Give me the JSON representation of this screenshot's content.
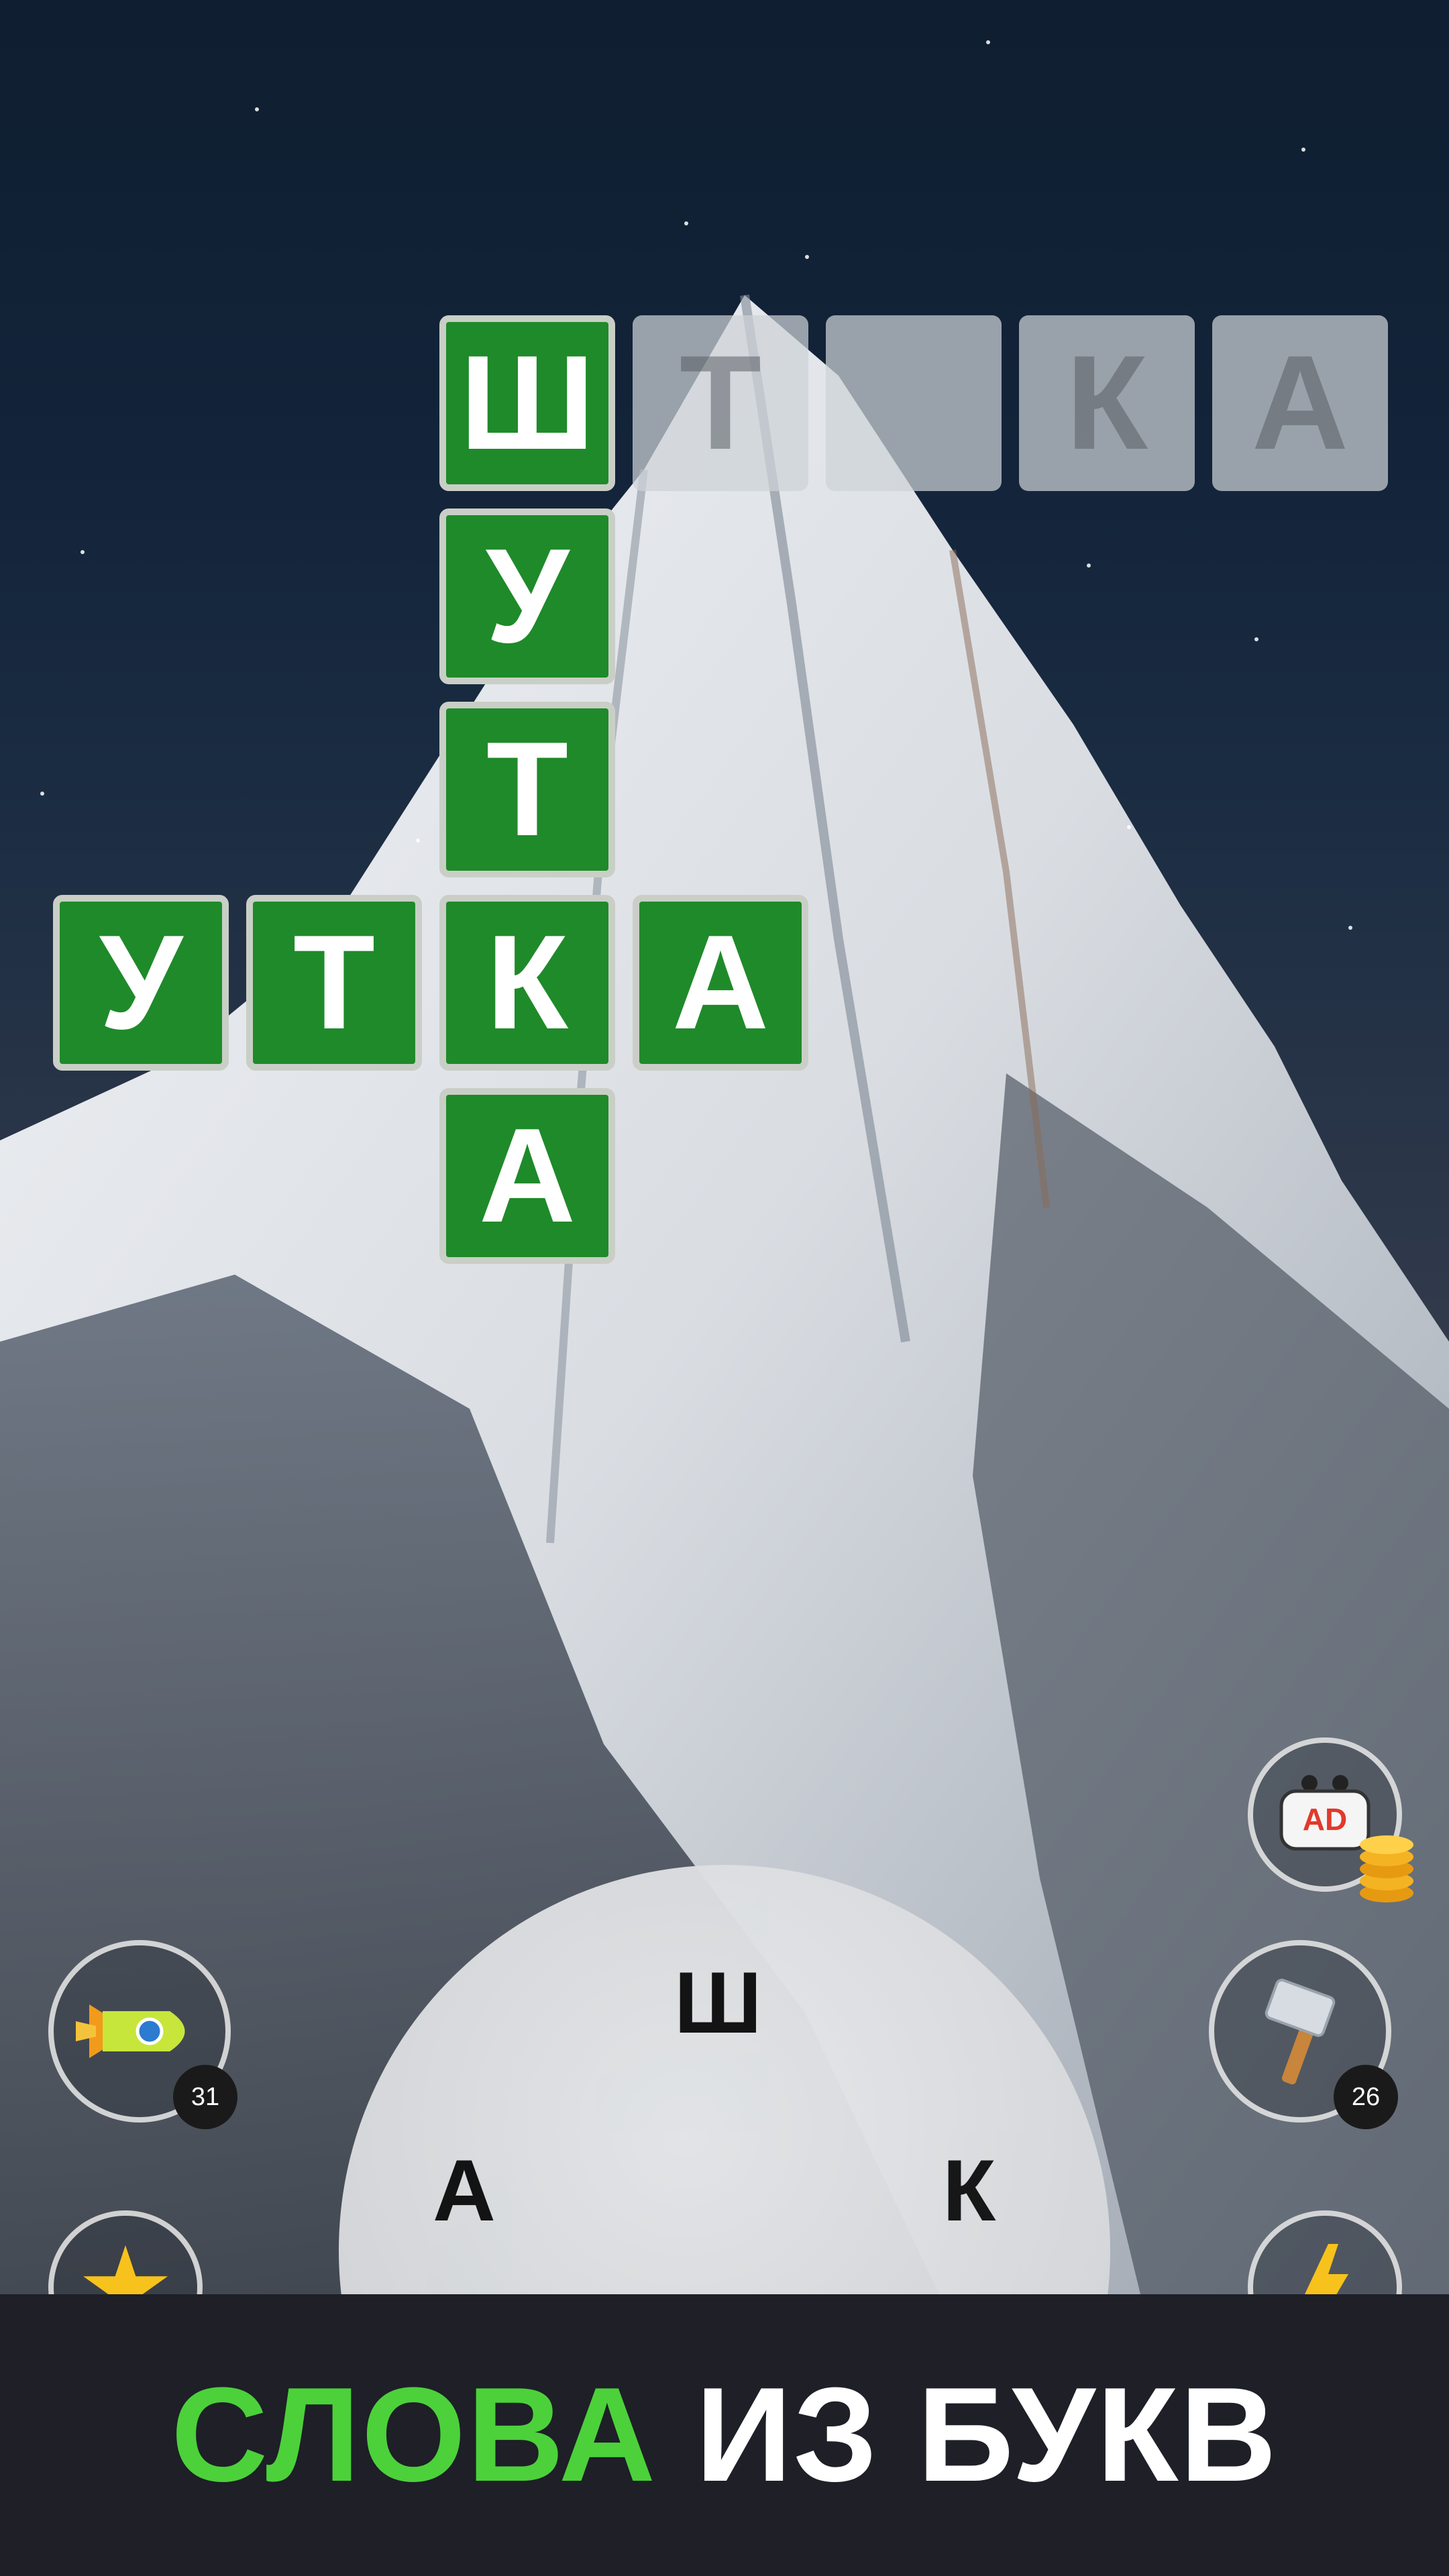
{
  "board": {
    "row_top": {
      "filled": [
        "Ш"
      ],
      "empty": [
        "Т",
        "",
        "К",
        "А"
      ]
    },
    "column": [
      "Ш",
      "У",
      "Т",
      "К",
      "А"
    ],
    "row_middle": [
      "У",
      "Т",
      "К",
      "А"
    ]
  },
  "wheel": {
    "letters": [
      "Ш",
      "А",
      "К"
    ]
  },
  "buttons": {
    "rocket": {
      "count": "31"
    },
    "hammer": {
      "count": "26"
    },
    "ad": {
      "label": "AD"
    }
  },
  "banner": {
    "green": "СЛОВА",
    "white": " ИЗ БУКВ"
  },
  "colors": {
    "tile_green": "#1f8a2a",
    "banner_green": "#4cd13a",
    "banner_bg": "#1e1f27"
  }
}
